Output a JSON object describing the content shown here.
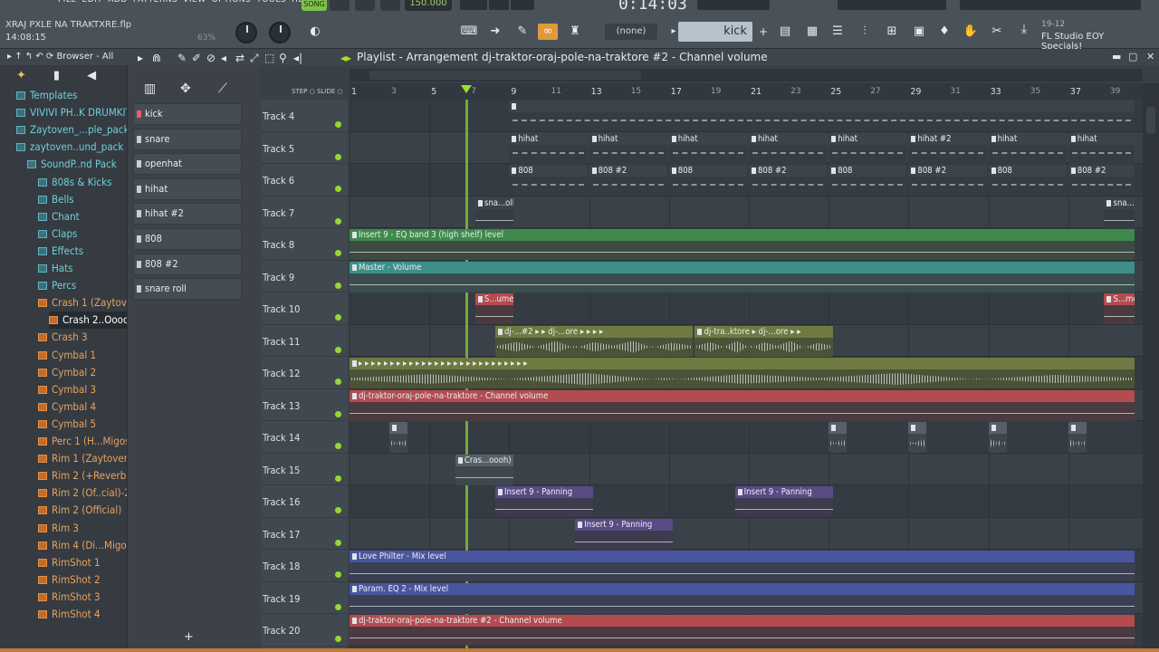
{
  "menubar": {
    "items": [
      "FILE",
      "EDIT",
      "ADD",
      "PATTERNS",
      "VIEW",
      "OPTIONS",
      "TOOLS",
      "HELP"
    ]
  },
  "project": {
    "name": "XRAJ PXLE NA TRAKTXRE.flp",
    "time": "14:08:15",
    "cpu": "63%"
  },
  "transport": {
    "song_label": "SONG",
    "tempo": "150.000",
    "time": "0:14:03"
  },
  "toolbar": {
    "pattern": "(none)",
    "channel": "kick",
    "hint_date": "19-12",
    "hint_text_1": "FL Studio EOY",
    "hint_text_2": "Specials!"
  },
  "browser": {
    "title": "Browser - All",
    "items": [
      {
        "label": "Templates",
        "type": "folder",
        "indent": 0
      },
      {
        "label": "VIVIVI PH..K DRUMKIT",
        "type": "folder",
        "indent": 0
      },
      {
        "label": "Zaytoven_...ple_pack",
        "type": "folder",
        "indent": 0
      },
      {
        "label": "zaytoven..und_pack",
        "type": "folder",
        "indent": 0
      },
      {
        "label": "SoundP..nd Pack",
        "type": "folder",
        "indent": 1
      },
      {
        "label": "808s & Kicks",
        "type": "folder",
        "indent": 2
      },
      {
        "label": "Bells",
        "type": "folder",
        "indent": 2
      },
      {
        "label": "Chant",
        "type": "folder",
        "indent": 2
      },
      {
        "label": "Claps",
        "type": "folder",
        "indent": 2
      },
      {
        "label": "Effects",
        "type": "folder",
        "indent": 2
      },
      {
        "label": "Hats",
        "type": "folder",
        "indent": 2
      },
      {
        "label": "Percs",
        "type": "folder",
        "indent": 2
      },
      {
        "label": "Crash 1 (Zaytoven)",
        "type": "file",
        "indent": 2
      },
      {
        "label": "Crash 2..Oooooh)",
        "type": "file",
        "indent": 3,
        "selected": true
      },
      {
        "label": "Crash 3",
        "type": "file",
        "indent": 2
      },
      {
        "label": "Cymbal 1",
        "type": "file",
        "indent": 2
      },
      {
        "label": "Cymbal 2",
        "type": "file",
        "indent": 2
      },
      {
        "label": "Cymbal 3",
        "type": "file",
        "indent": 2
      },
      {
        "label": "Cymbal 4",
        "type": "file",
        "indent": 2
      },
      {
        "label": "Cymbal 5",
        "type": "file",
        "indent": 2
      },
      {
        "label": "Perc 1 (H...Migos)",
        "type": "file",
        "indent": 2
      },
      {
        "label": "Rim 1 (Zaytoven)",
        "type": "file",
        "indent": 2
      },
      {
        "label": "Rim 2 (+Reverb)",
        "type": "file",
        "indent": 2
      },
      {
        "label": "Rim 2 (Of..cial)-24b",
        "type": "file",
        "indent": 2
      },
      {
        "label": "Rim 2 (Official)",
        "type": "file",
        "indent": 2
      },
      {
        "label": "Rim 3",
        "type": "file",
        "indent": 2
      },
      {
        "label": "Rim 4 (Di...Migos)",
        "type": "file",
        "indent": 2
      },
      {
        "label": "RimShot 1",
        "type": "file",
        "indent": 2
      },
      {
        "label": "RimShot 2",
        "type": "file",
        "indent": 2
      },
      {
        "label": "RimShot 3",
        "type": "file",
        "indent": 2
      },
      {
        "label": "RimShot 4",
        "type": "file",
        "indent": 2
      }
    ]
  },
  "picker": {
    "items": [
      {
        "label": "kick",
        "active": true
      },
      {
        "label": "snare"
      },
      {
        "label": "openhat"
      },
      {
        "label": "hihat"
      },
      {
        "label": "hihat #2"
      },
      {
        "label": "808"
      },
      {
        "label": "808 #2"
      },
      {
        "label": "snare roll"
      }
    ]
  },
  "playlist": {
    "title": "Playlist - Arrangement",
    "breadcrumb": "dj-traktor-oraj-pole-na-traktore #2 - Channel volume",
    "step_label": "STEP",
    "slide_label": "SLIDE",
    "ruler": [
      "1",
      "3",
      "5",
      "7",
      "9",
      "11",
      "13",
      "15",
      "17",
      "19",
      "21",
      "23",
      "25",
      "27",
      "29",
      "31",
      "33",
      "35",
      "37",
      "39"
    ],
    "tracks": [
      "Track 4",
      "Track 5",
      "Track 6",
      "Track 7",
      "Track 8",
      "Track 9",
      "Track 10",
      "Track 11",
      "Track 12",
      "Track 13",
      "Track 14",
      "Track 15",
      "Track 16",
      "Track 17",
      "Track 18",
      "Track 19",
      "Track 20"
    ],
    "clips": [
      {
        "label": "",
        "color": "pat",
        "row": 0,
        "bar": 9,
        "len": 31.4,
        "kind": "notes"
      },
      {
        "label": "hihat",
        "color": "pat",
        "row": 1,
        "bar": 9,
        "len": 4,
        "kind": "notes"
      },
      {
        "label": "hihat",
        "color": "pat",
        "row": 1,
        "bar": 13,
        "len": 4,
        "kind": "notes"
      },
      {
        "label": "hihat",
        "color": "pat",
        "row": 1,
        "bar": 17,
        "len": 4,
        "kind": "notes"
      },
      {
        "label": "hihat",
        "color": "pat",
        "row": 1,
        "bar": 21,
        "len": 4,
        "kind": "notes"
      },
      {
        "label": "hihat",
        "color": "pat",
        "row": 1,
        "bar": 25,
        "len": 4,
        "kind": "notes"
      },
      {
        "label": "hihat #2",
        "color": "pat",
        "row": 1,
        "bar": 29,
        "len": 4,
        "kind": "notes"
      },
      {
        "label": "hihat",
        "color": "pat",
        "row": 1,
        "bar": 33,
        "len": 4,
        "kind": "notes"
      },
      {
        "label": "hihat",
        "color": "pat",
        "row": 1,
        "bar": 37,
        "len": 3.4,
        "kind": "notes"
      },
      {
        "label": "808",
        "color": "pat",
        "row": 2,
        "bar": 9,
        "len": 4,
        "kind": "notes"
      },
      {
        "label": "808 #2",
        "color": "pat",
        "row": 2,
        "bar": 13,
        "len": 4,
        "kind": "notes"
      },
      {
        "label": "808",
        "color": "pat",
        "row": 2,
        "bar": 17,
        "len": 4,
        "kind": "notes"
      },
      {
        "label": "808 #2",
        "color": "pat",
        "row": 2,
        "bar": 21,
        "len": 4,
        "kind": "notes"
      },
      {
        "label": "808",
        "color": "pat",
        "row": 2,
        "bar": 25,
        "len": 4,
        "kind": "notes"
      },
      {
        "label": "808 #2",
        "color": "pat",
        "row": 2,
        "bar": 29,
        "len": 4,
        "kind": "notes"
      },
      {
        "label": "808",
        "color": "pat",
        "row": 2,
        "bar": 33,
        "len": 4,
        "kind": "notes"
      },
      {
        "label": "808 #2",
        "color": "pat",
        "row": 2,
        "bar": 37,
        "len": 3.4,
        "kind": "notes"
      },
      {
        "label": "sna...oll",
        "color": "pat",
        "row": 3,
        "bar": 7.3,
        "len": 2,
        "kind": "auto"
      },
      {
        "label": "sna...ll",
        "color": "pat",
        "row": 3,
        "bar": 38.8,
        "len": 1.6,
        "kind": "auto"
      },
      {
        "label": "Insert 9 - EQ band 3 (high shelf) level",
        "color": "green",
        "row": 4,
        "bar": 1,
        "len": 39.4,
        "kind": "auto"
      },
      {
        "label": "Master - Volume",
        "color": "teal",
        "row": 5,
        "bar": 1,
        "len": 39.4,
        "kind": "auto"
      },
      {
        "label": "S...ume",
        "color": "red",
        "row": 6,
        "bar": 7.3,
        "len": 2,
        "kind": "auto"
      },
      {
        "label": "S...me",
        "color": "red",
        "row": 6,
        "bar": 38.8,
        "len": 1.6,
        "kind": "auto"
      },
      {
        "label": "dj-...#2 ▸ ▸  dj-...ore ▸ ▸ ▸ ▸",
        "color": "olive",
        "row": 7,
        "bar": 8.3,
        "len": 10,
        "kind": "wave"
      },
      {
        "label": "dj-tra..ktore ▸ dj-...ore ▸ ▸",
        "color": "olive",
        "row": 7,
        "bar": 18.3,
        "len": 7,
        "kind": "wave"
      },
      {
        "label": "▸ ▸ ▸ ▸ ▸ ▸ ▸ ▸ ▸ ▸ ▸ ▸ ▸ ▸ ▸ ▸ ▸ ▸ ▸ ▸ ▸ ▸ ▸ ▸ ▸ ▸ ▸",
        "color": "olive",
        "row": 8,
        "bar": 1,
        "len": 39.4,
        "kind": "wave"
      },
      {
        "label": "dj-traktor-oraj-pole-na-traktore - Channel volume",
        "color": "red",
        "row": 9,
        "bar": 1,
        "len": 39.4,
        "kind": "auto"
      },
      {
        "label": "",
        "color": "gray",
        "row": 10,
        "bar": 3,
        "len": 1,
        "kind": "wave"
      },
      {
        "label": "",
        "color": "gray",
        "row": 10,
        "bar": 25,
        "len": 1,
        "kind": "wave"
      },
      {
        "label": "",
        "color": "gray",
        "row": 10,
        "bar": 29,
        "len": 1,
        "kind": "wave"
      },
      {
        "label": "",
        "color": "gray",
        "row": 10,
        "bar": 33,
        "len": 1,
        "kind": "wave"
      },
      {
        "label": "",
        "color": "gray",
        "row": 10,
        "bar": 37,
        "len": 1,
        "kind": "wave"
      },
      {
        "label": "Cras...oooh)",
        "color": "gray",
        "row": 11,
        "bar": 6.3,
        "len": 3,
        "kind": "auto"
      },
      {
        "label": "Insert 9 - Panning",
        "color": "purple",
        "row": 12,
        "bar": 8.3,
        "len": 5,
        "kind": "auto"
      },
      {
        "label": "Insert 9 - Panning",
        "color": "purple",
        "row": 12,
        "bar": 20.3,
        "len": 5,
        "kind": "auto"
      },
      {
        "label": "Insert 9 - Panning",
        "color": "purple",
        "row": 13,
        "bar": 12.3,
        "len": 5,
        "kind": "auto"
      },
      {
        "label": "Love Philter - Mix level",
        "color": "blue",
        "row": 14,
        "bar": 1,
        "len": 39.4,
        "kind": "auto"
      },
      {
        "label": "Param. EQ 2 - Mix level",
        "color": "blue",
        "row": 15,
        "bar": 1,
        "len": 39.4,
        "kind": "auto"
      },
      {
        "label": "dj-traktor-oraj-pole-na-traktore #2 - Channel volume",
        "color": "red",
        "row": 16,
        "bar": 1,
        "len": 39.4,
        "kind": "auto"
      }
    ]
  }
}
